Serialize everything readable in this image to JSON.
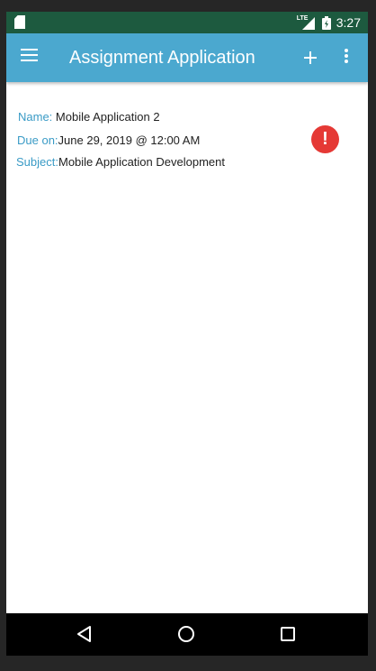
{
  "status_bar": {
    "network": "LTE",
    "time": "3:27",
    "icons": [
      "sd-card-icon",
      "lte-signal-icon",
      "battery-icon"
    ]
  },
  "app_bar": {
    "title": "Assignment Application",
    "icons": [
      "menu-icon",
      "add-icon",
      "more-vert-icon"
    ],
    "color": "#4ba8cf"
  },
  "assignment": {
    "name_label": "Name:",
    "name_value": "Mobile Application 2",
    "due_label": "Due on:",
    "due_value": "June 29, 2019 @ 12:00 AM",
    "subject_label": "Subject:",
    "subject_value": "Mobile Application Development",
    "status_icon": "alert-icon",
    "status_glyph": "!",
    "status_color": "#e53935"
  },
  "nav_bar": {
    "icons": [
      "back-icon",
      "home-icon",
      "recents-icon"
    ]
  },
  "colors": {
    "status_bar": "#1d5a3f",
    "label": "#3a9bc6",
    "value": "#222222"
  }
}
